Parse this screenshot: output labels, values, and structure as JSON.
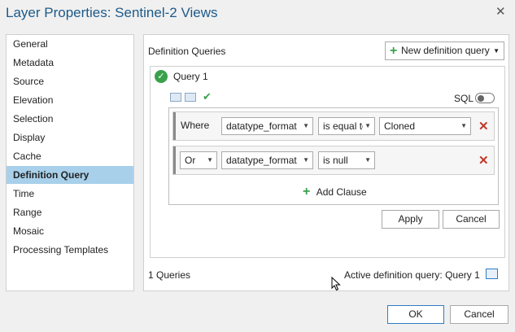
{
  "window": {
    "title": "Layer Properties: Sentinel-2 Views",
    "close_glyph": "✕"
  },
  "sidebar": {
    "items": [
      {
        "label": "General"
      },
      {
        "label": "Metadata"
      },
      {
        "label": "Source"
      },
      {
        "label": "Elevation"
      },
      {
        "label": "Selection"
      },
      {
        "label": "Display"
      },
      {
        "label": "Cache"
      },
      {
        "label": "Definition Query",
        "selected": true
      },
      {
        "label": "Time"
      },
      {
        "label": "Range"
      },
      {
        "label": "Mosaic"
      },
      {
        "label": "Processing Templates"
      }
    ]
  },
  "main": {
    "section_label": "Definition Queries",
    "new_query_label": "New definition query",
    "query": {
      "name": "Query 1",
      "sql_label": "SQL",
      "sql_enabled": false,
      "clauses": [
        {
          "connector": "Where",
          "field": "datatype_format",
          "operator": "is equal to",
          "value": "Cloned"
        },
        {
          "connector": "Or",
          "field": "datatype_format",
          "operator": "is null",
          "value": ""
        }
      ],
      "add_clause_label": "Add Clause",
      "apply_label": "Apply",
      "cancel_label": "Cancel"
    },
    "query_count": "1 Queries",
    "active_query": "Active definition query: Query 1"
  },
  "footer": {
    "ok_label": "OK",
    "cancel_label": "Cancel"
  },
  "colors": {
    "accent": "#2d7dc4",
    "selected": "#a8d0ea",
    "success": "#3aa14a",
    "delete": "#c0392b"
  }
}
